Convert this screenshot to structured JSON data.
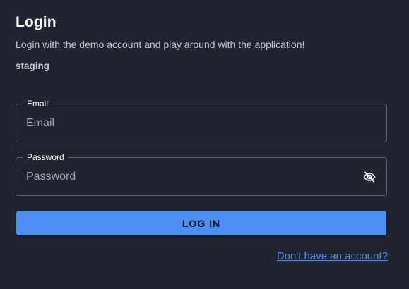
{
  "header": {
    "title": "Login",
    "subtitle": "Login with the demo account and play around with the application!",
    "environment": "staging"
  },
  "form": {
    "email": {
      "label": "Email",
      "placeholder": "Email",
      "value": ""
    },
    "password": {
      "label": "Password",
      "placeholder": "Password",
      "value": "",
      "toggle_icon": "eye-off-icon"
    },
    "submit_label": "LOG IN",
    "signup_link": "Don't have an account?"
  },
  "colors": {
    "background": "#212330",
    "accent": "#4c8df6",
    "border": "#5a5e6b"
  }
}
